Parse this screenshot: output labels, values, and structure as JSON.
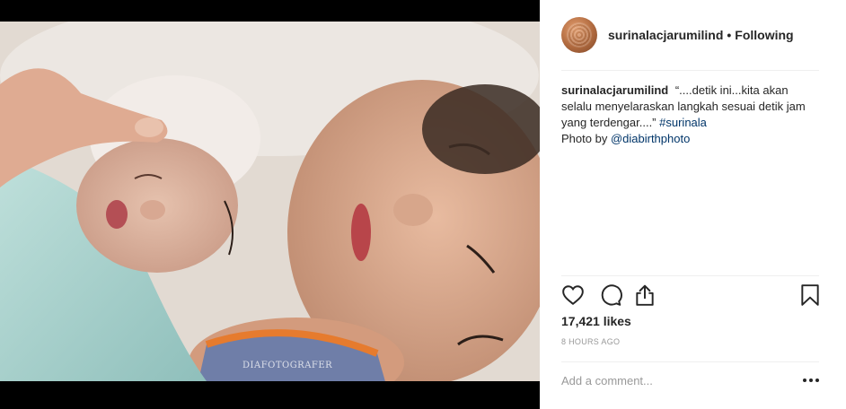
{
  "post": {
    "username": "surinalacjarumilind",
    "follow_separator": "•",
    "follow_status": "Following",
    "watermark": "DIAFOTOGRAFER"
  },
  "caption": {
    "username": "surinalacjarumilind",
    "text": "“....detik ini...kita akan selalu menyelaraskan langkah sesuai detik jam yang terdengar....”",
    "hashtag": "#surinala",
    "credit_prefix": "Photo by",
    "mention": "@diabirthphoto"
  },
  "actions": {
    "like_icon": "heart-icon",
    "comment_icon": "comment-bubble-icon",
    "share_icon": "share-upload-icon",
    "save_icon": "bookmark-icon"
  },
  "likes": "17,421 likes",
  "timestamp": "8 HOURS AGO",
  "comment_box": {
    "placeholder": "Add a comment...",
    "more_icon": "more-options-icon"
  },
  "colors": {
    "link": "#003569",
    "text": "#262626",
    "muted": "#999999",
    "divider": "#efefef"
  }
}
